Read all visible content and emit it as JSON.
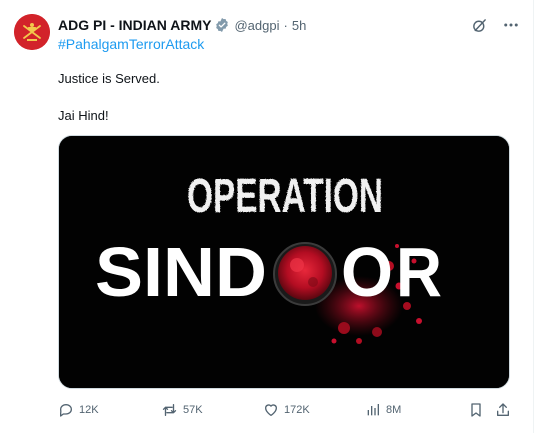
{
  "tweet": {
    "author_name": "ADG PI - INDIAN ARMY",
    "handle": "@adgpi",
    "separator": "·",
    "time": "5h",
    "hashtag": "#PahalgamTerrorAttack",
    "body_line1": "Justice is Served.",
    "body_line2": "Jai Hind!"
  },
  "media": {
    "title_top": "OPERATION",
    "title_left": "SIND",
    "title_right": "R"
  },
  "stats": {
    "replies": "12K",
    "reposts": "57K",
    "likes": "172K",
    "views": "8M"
  },
  "colors": {
    "link": "#1d9bf0",
    "muted": "#536471",
    "text": "#0f1419",
    "sindoor_red": "#c8102e",
    "avatar_bg": "#d2232a"
  },
  "icons": [
    "grok-icon",
    "more-icon",
    "reply-icon",
    "retweet-icon",
    "like-icon",
    "views-icon",
    "bookmark-icon",
    "share-icon",
    "verified-badge-icon"
  ]
}
